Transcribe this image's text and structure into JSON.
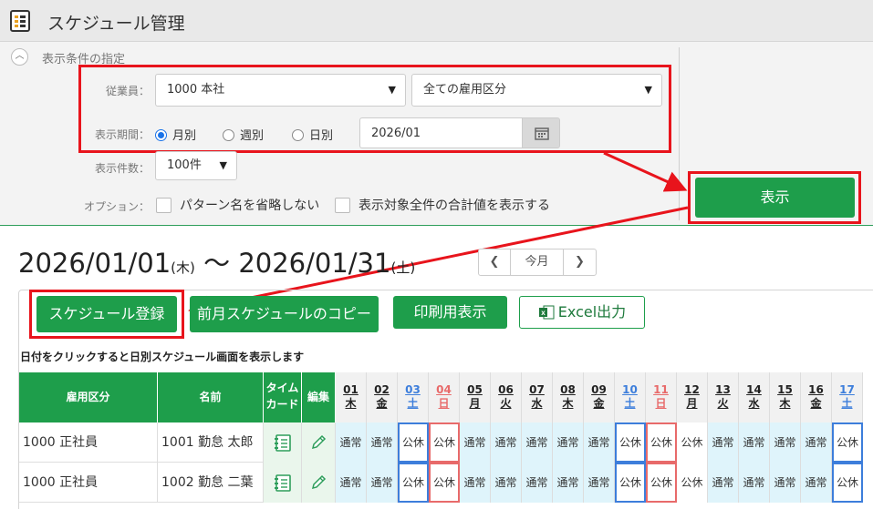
{
  "window": {
    "title": "スケジュール管理"
  },
  "conditions": {
    "section_title": "表示条件の指定",
    "employee_label": "従業員：",
    "employee_value": "1000 本社",
    "employment_type_value": "全ての雇用区分",
    "period_label": "表示期間：",
    "period_options": [
      "月別",
      "週別",
      "日別"
    ],
    "period_selected": "月別",
    "period_date": "2026/01",
    "count_label": "表示件数：",
    "count_value": "100件",
    "option_label": "オプション：",
    "option_1": "パターン名を省略しない",
    "option_2": "表示対象全件の合計値を表示する",
    "show_button": "表示"
  },
  "range": {
    "start": "2026/01/01",
    "start_dow": "(木)",
    "sep": " ～ ",
    "end": "2026/01/31",
    "end_dow": "(土)",
    "today_label": "今月"
  },
  "actions": {
    "register": "スケジュール登録",
    "copy_prev": "前月スケジュールのコピー",
    "print": "印刷用表示",
    "excel": "Excel出力"
  },
  "hint": "日付をクリックすると日別スケジュール画面を表示します",
  "table": {
    "headers": {
      "type": "雇用区分",
      "name": "名前",
      "timecard": "タイム\nカード",
      "edit": "編集"
    },
    "days": [
      {
        "d": "01",
        "w": "木",
        "k": "n"
      },
      {
        "d": "02",
        "w": "金",
        "k": "n"
      },
      {
        "d": "03",
        "w": "土",
        "k": "sat"
      },
      {
        "d": "04",
        "w": "日",
        "k": "sun"
      },
      {
        "d": "05",
        "w": "月",
        "k": "n"
      },
      {
        "d": "06",
        "w": "火",
        "k": "n"
      },
      {
        "d": "07",
        "w": "水",
        "k": "n"
      },
      {
        "d": "08",
        "w": "木",
        "k": "n"
      },
      {
        "d": "09",
        "w": "金",
        "k": "n"
      },
      {
        "d": "10",
        "w": "土",
        "k": "sat"
      },
      {
        "d": "11",
        "w": "日",
        "k": "sun"
      },
      {
        "d": "12",
        "w": "月",
        "k": "n"
      },
      {
        "d": "13",
        "w": "火",
        "k": "n"
      },
      {
        "d": "14",
        "w": "水",
        "k": "n"
      },
      {
        "d": "15",
        "w": "木",
        "k": "n"
      },
      {
        "d": "16",
        "w": "金",
        "k": "n"
      },
      {
        "d": "17",
        "w": "土",
        "k": "sat"
      }
    ],
    "rows": [
      {
        "type": "1000 正社員",
        "name": "1001 勤怠 太郎",
        "cells": [
          "通常",
          "通常",
          "公休",
          "公休",
          "通常",
          "通常",
          "通常",
          "通常",
          "通常",
          "公休",
          "公休",
          "公休",
          "通常",
          "通常",
          "通常",
          "通常",
          "公休"
        ]
      },
      {
        "type": "1000 正社員",
        "name": "1002 勤怠 二葉",
        "cells": [
          "通常",
          "通常",
          "公休",
          "公休",
          "通常",
          "通常",
          "通常",
          "通常",
          "通常",
          "公休",
          "公休",
          "公休",
          "通常",
          "通常",
          "通常",
          "通常",
          "公休"
        ]
      }
    ]
  },
  "colors": {
    "accent": "#1e9e4b",
    "highlight": "#e8141c",
    "saturday": "#3d7edb",
    "sunday": "#e86a6a",
    "workday_bg": "#dff4fb"
  }
}
